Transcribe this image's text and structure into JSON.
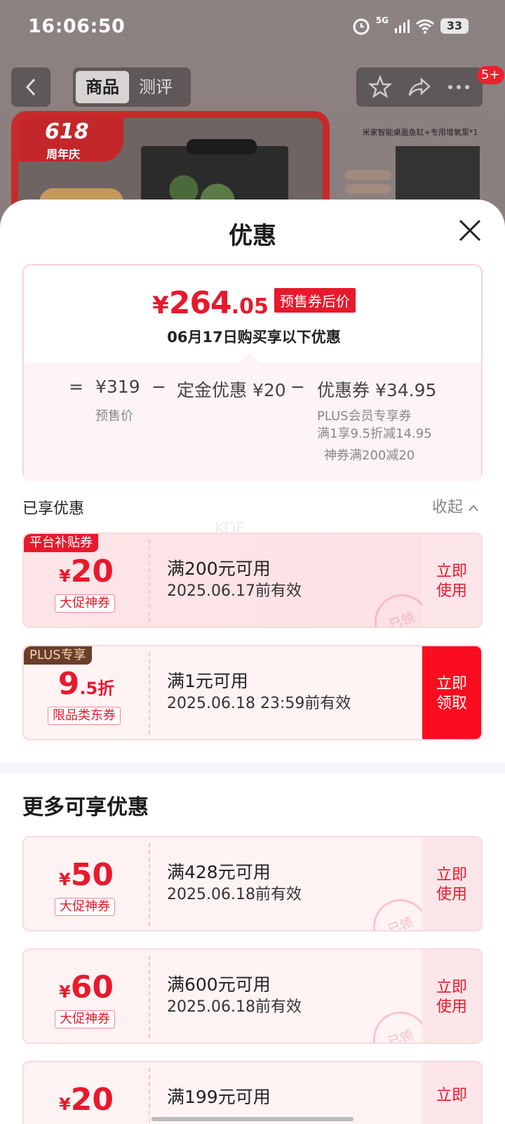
{
  "status_bar": {
    "time": "16:06:50",
    "battery": "33",
    "network": "5G"
  },
  "nav": {
    "tab_product": "商品",
    "tab_review": "测评",
    "badge": "5+"
  },
  "background": {
    "promo_big": "618",
    "promo_small": "周年庆",
    "thumb_title": "米家智能桌面鱼缸+专用增氧泵*1"
  },
  "sheet": {
    "title": "优惠",
    "summary": {
      "price_yen": "¥",
      "price_int": "264",
      "price_dec": ".05",
      "price_tag": "预售券后价",
      "subtitle": "06月17日购买享以下优惠",
      "eq": "=",
      "presale_price": "¥319",
      "presale_label": "预售价",
      "minus1": "−",
      "deposit": "定金优惠 ¥20",
      "minus2": "−",
      "coupon_total": "优惠券 ¥34.95",
      "coupon_detail_1": "PLUS会员专享券",
      "coupon_detail_2": "满1享9.5折减14.95",
      "coupon_detail_3": "神券满200减20"
    },
    "enjoyed_label": "已享优惠",
    "collapse_label": "收起",
    "watermark": "KOF",
    "enjoyed_coupons": [
      {
        "corner": "平台补贴券",
        "yen": "¥",
        "amount": "20",
        "kind": "大促神券",
        "condition": "满200元可用",
        "validity": "2025.06.17前有效",
        "action": "立即使用",
        "stamp": "已领"
      },
      {
        "corner": "PLUS专享",
        "amount": "9",
        "amount_small": ".5折",
        "kind": "限品类东券",
        "condition": "满1元可用",
        "validity": "2025.06.18 23:59前有效",
        "action": "立即领取"
      }
    ],
    "more_title": "更多可享优惠",
    "more_coupons": [
      {
        "yen": "¥",
        "amount": "50",
        "kind": "大促神券",
        "condition": "满428元可用",
        "validity": "2025.06.18前有效",
        "action": "立即使用",
        "stamp": "已领"
      },
      {
        "yen": "¥",
        "amount": "60",
        "kind": "大促神券",
        "condition": "满600元可用",
        "validity": "2025.06.18前有效",
        "action": "立即使用",
        "stamp": "已领"
      },
      {
        "yen": "¥",
        "amount": "20",
        "condition": "满199元可用",
        "action": "立即"
      }
    ],
    "colors": {
      "accent_red": "#e8192c",
      "solid_red": "#fa0d1f",
      "platform_tag": "#e8192c",
      "plus_tag": "#6b3e2a"
    }
  }
}
